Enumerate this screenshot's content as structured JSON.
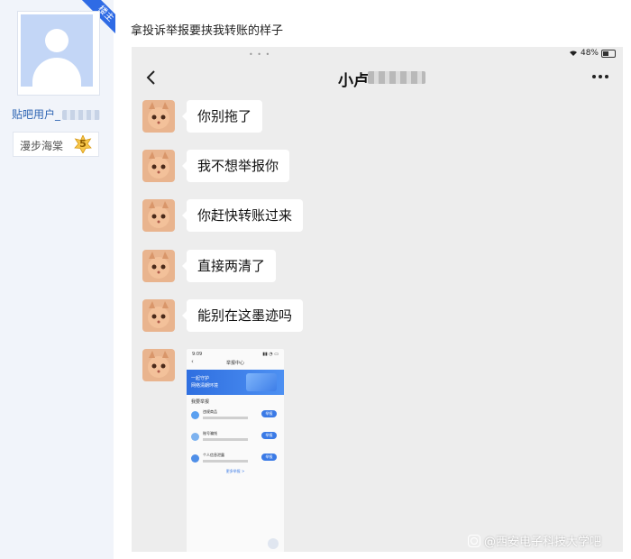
{
  "author": {
    "badge": "楼主",
    "username": "贴吧用户_",
    "level_name": "漫步海棠",
    "level": "5"
  },
  "post": {
    "text": "拿投诉举报要挟我转账的样子"
  },
  "chat": {
    "status": {
      "right": "48%"
    },
    "title": "小卢",
    "messages": [
      "你别拖了",
      "我不想举报你",
      "你赶快转账过来",
      "直接两清了",
      "能别在这墨迹吗"
    ]
  },
  "screenshot": {
    "time": "9:09",
    "title": "举报中心",
    "banner_line1": "一起守护",
    "banner_line2": "网络清朗环境",
    "section": "我要举报",
    "items": [
      {
        "name": "违规商品",
        "button": "举报"
      },
      {
        "name": "账号骗钱",
        "button": "举报"
      },
      {
        "name": "个人信息泄露",
        "button": "举报"
      }
    ],
    "more": "更多举报 >"
  },
  "watermark": "@西安电子科技大学吧",
  "colors": {
    "sidebar_bg": "#f1f4fa",
    "link_blue": "#2d64b3",
    "ribbon_blue": "#2f6be5",
    "chat_bg": "#ededed",
    "bubble_bg": "#ffffff"
  }
}
